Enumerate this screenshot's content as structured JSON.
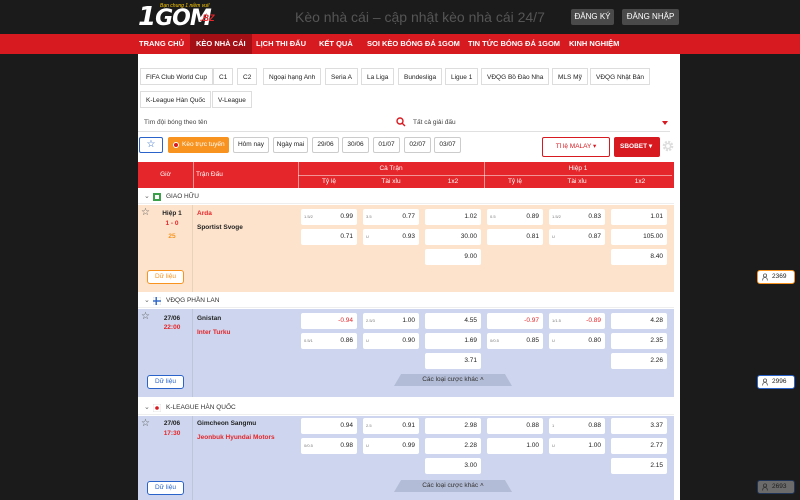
{
  "header": {
    "logo_main": "GOM",
    "logo_one": "1",
    "logo_tagline": "Bạn chung 1 niềm vui!",
    "logo_suffix": ".BZ",
    "site_title": "Kèo nhà cái – cập nhật kèo nhà cái 24/7",
    "register": "ĐĂNG KÝ",
    "login": "ĐĂNG NHẬP"
  },
  "nav": [
    "TRANG CHỦ",
    "KÈO NHÀ CÁI",
    "LỊCH THI ĐẤU",
    "KẾT QUẢ",
    "SOI KÈO BÓNG ĐÁ 1GOM",
    "TIN TỨC BÓNG ĐÁ 1GOM",
    "KINH NGHIỆM"
  ],
  "leagues": [
    "FIFA Club World Cup",
    "C1",
    "C2",
    "Ngoại hạng Anh",
    "Seria A",
    "La Liga",
    "Bundesliga",
    "Ligue 1",
    "VĐQG Bồ Đào Nha",
    "MLS Mỹ",
    "VĐQG Nhật Bản",
    "K-League Hàn Quốc",
    "V-League"
  ],
  "search": {
    "team_placeholder": "Tìm đội bóng theo tên",
    "league_select": "Tất cả giải đấu"
  },
  "filters": {
    "live": "Kèo trực tuyến",
    "dates": [
      "Hôm nay",
      "Ngày mai",
      "29/06",
      "30/06",
      "01/07",
      "02/07",
      "03/07"
    ]
  },
  "odds_format": "Tỉ lệ MALAY",
  "bookmaker": "SBOBET",
  "table_header": {
    "time": "Giờ",
    "match": "Trận Đấu",
    "full": "Cả Trận",
    "half": "Hiệp 1",
    "cols": [
      "Tỷ lệ",
      "Tài xỉu",
      "1x2",
      "Tỷ lệ",
      "Tài xỉu",
      "1x2"
    ]
  },
  "groups": [
    {
      "league": "GIAO HỮU",
      "time": "Hiệp 1",
      "score": "1 - 0",
      "minute": "25",
      "home": "Arda",
      "away": "Sportist Svoge",
      "cells": [
        [
          "1.5/2",
          "0.99",
          "",
          "0.71",
          "",
          ""
        ],
        [
          "3.5",
          "0.77",
          "U",
          "0.93",
          "",
          ""
        ],
        [
          "",
          "1.02",
          "",
          "30.00",
          "",
          "9.00"
        ],
        [
          "0.5",
          "0.89",
          "",
          "0.81",
          "",
          ""
        ],
        [
          "1.5/2",
          "0.83",
          "U",
          "0.87",
          "",
          ""
        ],
        [
          "",
          "1.01",
          "",
          "105.00",
          "",
          "8.40"
        ]
      ],
      "data_label": "Dữ liệu",
      "views": "2369"
    },
    {
      "league": "VĐQG PHẦN LAN",
      "date": "27/06",
      "kickoff": "22:00",
      "home": "Gnistan",
      "away": "Inter Turku",
      "cells": [
        [
          "",
          "-0.94",
          "0.5/1",
          "0.86",
          "",
          ""
        ],
        [
          "2.5/3",
          "1.00",
          "U",
          "0.90",
          "",
          ""
        ],
        [
          "",
          "4.55",
          "",
          "1.69",
          "",
          "3.71"
        ],
        [
          "",
          "-0.97",
          "0/0.5",
          "0.85",
          "",
          ""
        ],
        [
          "1/1.5",
          "-0.89",
          "U",
          "0.80",
          "",
          ""
        ],
        [
          "",
          "4.28",
          "",
          "2.35",
          "",
          "2.26"
        ]
      ],
      "data_label": "Dữ liệu",
      "more": "Các loại cược khác",
      "views": "2996"
    },
    {
      "league": "K-LEAGUE HÀN QUỐC",
      "date": "27/06",
      "kickoff": "17:30",
      "home": "Gimcheon Sangmu",
      "away": "Jeonbuk Hyundai Motors",
      "cells": [
        [
          "",
          "0.94",
          "0/0.5",
          "0.98",
          "",
          ""
        ],
        [
          "2.5",
          "0.91",
          "U",
          "0.99",
          "",
          ""
        ],
        [
          "",
          "2.98",
          "",
          "2.28",
          "",
          "3.00"
        ],
        [
          "",
          "0.88",
          "",
          "1.00",
          "",
          ""
        ],
        [
          "1",
          "0.88",
          "U",
          "1.00",
          "",
          ""
        ],
        [
          "",
          "3.37",
          "",
          "2.77",
          "",
          "2.15"
        ]
      ],
      "data_label": "Dữ liệu",
      "more": "Các loại cược khác",
      "views": "2693"
    }
  ],
  "colors": {
    "brand_red": "#d71920",
    "live_orange": "#f7931e",
    "link_blue": "#2a63c9",
    "row_orange": "#fde3cc",
    "row_blue": "#cdd6ee"
  }
}
